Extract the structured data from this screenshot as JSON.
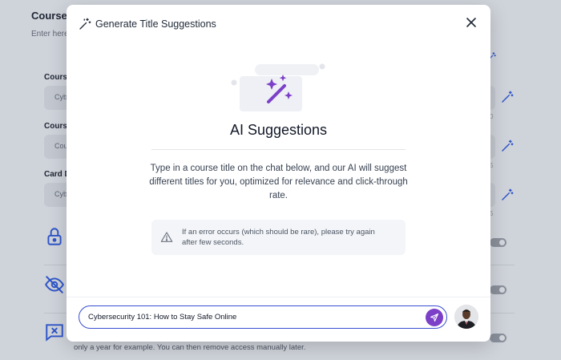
{
  "background": {
    "title": "Course",
    "subtitle": "Enter here",
    "fields": [
      {
        "label": "Cours",
        "value": "Cyb",
        "counter": ""
      },
      {
        "label": "Cours",
        "value": "Cou",
        "counter": "0"
      },
      {
        "label": "Card D",
        "value": "Cyb",
        "counter": "5"
      }
    ],
    "third_counter": "5",
    "footer_text": "only a year for example. You can then remove access manually later."
  },
  "modal": {
    "header_title": "Generate Title Suggestions",
    "heading": "AI Suggestions",
    "description": "Type in a course title on the chat below, and our AI will suggest different titles for you, optimized for relevance and click-through rate.",
    "notice": "If an error occurs (which should be rare), please try again after few seconds.",
    "chat": {
      "value": "Cybersecurity 101: How to Stay Safe Online"
    }
  },
  "colors": {
    "accent": "#7b3fc8",
    "input_border": "#3a4fd1",
    "wand_blue": "#2f55c9"
  },
  "icons": [
    "magic-wand-icon",
    "close-icon",
    "warning-icon",
    "send-icon",
    "lock-icon",
    "eye-off-icon",
    "message-x-icon"
  ]
}
